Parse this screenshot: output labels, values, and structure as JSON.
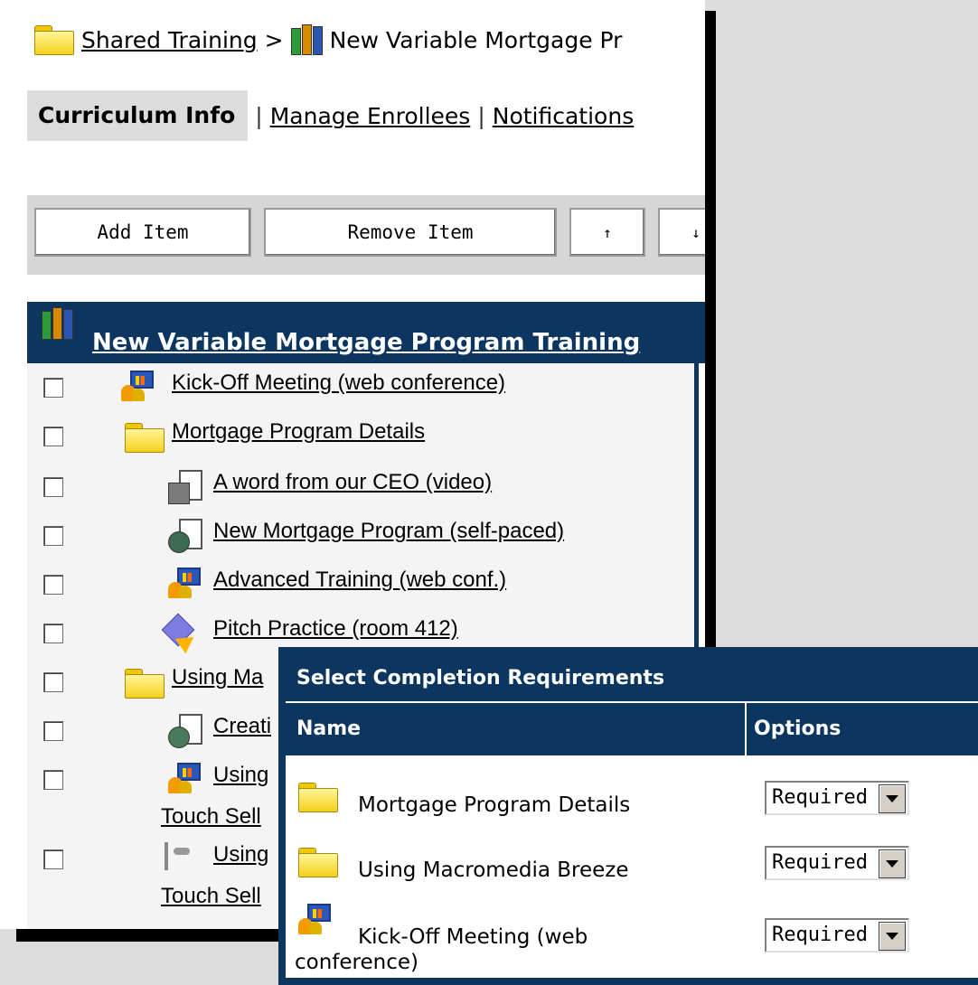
{
  "breadcrumb": {
    "root": "Shared Training",
    "separator": ">",
    "current": "New Variable Mortgage Pr"
  },
  "tabs": {
    "active": "Curriculum Info",
    "sep": "|",
    "manage": "Manage Enrollees",
    "notifications": "Notifications"
  },
  "toolbar": {
    "add": "Add Item",
    "remove": "Remove Item",
    "up": "↑",
    "down": "↓"
  },
  "curriculum": {
    "title": "New Variable Mortgage Program Training",
    "items": [
      {
        "label": "Kick-Off Meeting (web conference)",
        "icon": "web-conference-icon"
      },
      {
        "label": "Mortgage Program Details",
        "icon": "folder-icon"
      },
      {
        "label": "A word from our CEO (video)",
        "icon": "video-document-icon"
      },
      {
        "label": "New Mortgage Program (self-paced)",
        "icon": "self-paced-document-icon"
      },
      {
        "label": "Advanced Training (web conf.)",
        "icon": "web-conference-icon"
      },
      {
        "label": "Pitch Practice (room 412)",
        "icon": "classroom-icon"
      },
      {
        "label": "Using Ma",
        "icon": "folder-icon"
      },
      {
        "label": "Creati",
        "icon": "presentation-document-icon"
      },
      {
        "label": "Using",
        "label2": "Touch Sell",
        "icon": "web-conference-icon"
      },
      {
        "label": "Using",
        "label2": "Touch Sell",
        "icon": "tape-icon"
      }
    ]
  },
  "dialog": {
    "title": "Select Completion Requirements",
    "col_name": "Name",
    "col_options": "Options",
    "rows": [
      {
        "name": "Mortgage Program Details",
        "option": "Required",
        "icon": "folder-icon"
      },
      {
        "name": "Using Macromedia Breeze",
        "option": "Required",
        "icon": "folder-icon"
      },
      {
        "name_line1": "Kick-Off Meeting (web",
        "name_line2": "conference)",
        "option": "Required",
        "icon": "web-conference-icon"
      }
    ]
  },
  "colors": {
    "header_blue": "#0c3660",
    "toolbar_gray": "#d6d6d6",
    "tree_bg": "#f4f4f4"
  }
}
